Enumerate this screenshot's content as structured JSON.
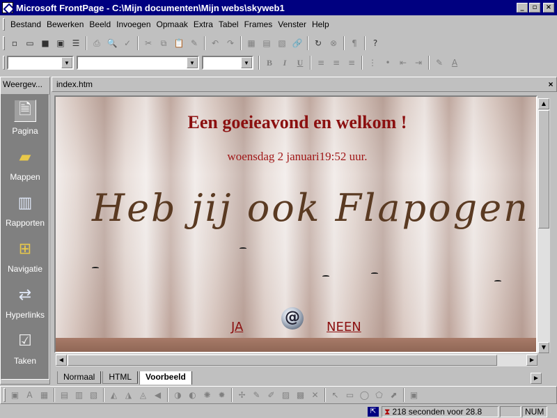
{
  "window": {
    "title": "Microsoft FrontPage - C:\\Mijn documenten\\Mijn webs\\skyweb1",
    "minimize": "_",
    "restore": "▫",
    "close": "×"
  },
  "menu": [
    "Bestand",
    "Bewerken",
    "Beeld",
    "Invoegen",
    "Opmaak",
    "Extra",
    "Tabel",
    "Frames",
    "Venster",
    "Help"
  ],
  "toolbar_icons": {
    "new": "▫",
    "open": "▭",
    "save": "■",
    "publish": "▣",
    "folder_list": "☰",
    "print": "⎙",
    "print_preview": "🔍",
    "spelling": "✓",
    "cut": "✂",
    "copy": "⧉",
    "paste": "📋",
    "format_painter": "✎",
    "undo": "↶",
    "redo": "↷",
    "insert_component": "▦",
    "insert_table": "▤",
    "insert_image": "▧",
    "hyperlink": "🔗",
    "refresh": "↻",
    "stop": "⊗",
    "show_all": "¶",
    "help": "?"
  },
  "format_icons": {
    "bold": "B",
    "italic": "I",
    "underline": "U",
    "align_left": "≡",
    "center": "≡",
    "align_right": "≡",
    "numbering": "⋮",
    "bullets": "•",
    "decrease_indent": "⇤",
    "increase_indent": "⇥",
    "highlight": "✎",
    "font_color": "A"
  },
  "views": {
    "header": "Weergev...",
    "items": [
      {
        "label": "Pagina",
        "icon": "🗎"
      },
      {
        "label": "Mappen",
        "icon": "▰"
      },
      {
        "label": "Rapporten",
        "icon": "▥"
      },
      {
        "label": "Navigatie",
        "icon": "⊞"
      },
      {
        "label": "Hyperlinks",
        "icon": "⇄"
      },
      {
        "label": "Taken",
        "icon": "☑"
      }
    ]
  },
  "document": {
    "filename": "index.htm",
    "close": "×",
    "welcome": "Een goeieavond en welkom !",
    "date": "woensdag 2 januari19:52 uur.",
    "headline": "Heb jij ook Flapogen ?",
    "yes_link": "JA",
    "no_link": "NEEN",
    "email_icon": "@"
  },
  "view_tabs": [
    "Normaal",
    "HTML",
    "Voorbeeld"
  ],
  "drawing_icons": [
    "▣",
    "A",
    "▦",
    "▤",
    "▥",
    "▧",
    "◭",
    "◮",
    "◬",
    "◀",
    "◑",
    "◐",
    "✺",
    "✹",
    "✢",
    "✎",
    "✐",
    "▨",
    "▩",
    "✕",
    "↖",
    "▭",
    "◯",
    "⬠",
    "⬈",
    "▣"
  ],
  "status": {
    "seconds": "218 seconden voor 28.8",
    "num": "NUM"
  },
  "colors": {
    "titlebar": "#000080",
    "heading": "#8b1010",
    "headline": "#5a3a22"
  }
}
